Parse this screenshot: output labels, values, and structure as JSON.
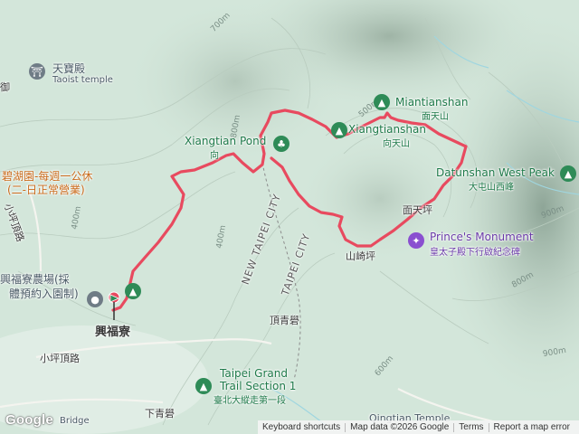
{
  "map": {
    "route_color": "#e84a5f",
    "labels": {
      "tianbao_zh": "天寶殿",
      "tianbao_en": "Taoist temple",
      "miantianshan_en": "Miantianshan",
      "miantianshan_zh": "面天山",
      "xiangtian_en": "Xiangtian Pond",
      "xiangtian_zh": "向",
      "xiangtianshan_en": "Xiangtianshan",
      "xiangtianshan_zh": "向天山",
      "datun_west_en": "Datunshan West Peak",
      "datun_west_zh": "大屯山西峰",
      "mian_tianping": "面天坪",
      "prince_en": "Prince's Monument",
      "prince_zh": "皇太子殿下行啟紀念碑",
      "shanyu": "山崎坪",
      "biyu_line1": "碧湖園-每週一公休",
      "biyu_line2": "(二-日正常營業)",
      "xingfu_farm1": "興福寮農場(採",
      "xingfu_farm2": "體預約入園制)",
      "xingfuliao": "興福寮",
      "new_taipei": "NEW TAIPEI CITY",
      "taipei": "TAIPEI CITY",
      "dingqing": "頂青礐",
      "xiaping_top": "小坪頂路",
      "xiaping_left": "小坪頂路",
      "trail_en1": "Taipei Grand",
      "trail_en2": "Trail Section 1",
      "trail_zh": "臺北大縱走第一段",
      "xiaqing": "下青礐",
      "qingtian": "Qingtian Temple",
      "bridge": "Bridge",
      "left_edge_zh": "御",
      "c700a": "700m",
      "c600a": "600m",
      "c500a": "500m",
      "c400a": "400m",
      "c400b": "400m",
      "c800a": "800m",
      "c900a": "900m",
      "c800b": "800m",
      "c900b": "900m"
    }
  },
  "footer": {
    "keyboard": "Keyboard shortcuts",
    "mapdata": "Map data ©2026 Google",
    "terms": "Terms",
    "report": "Report a map error"
  },
  "logo": "Google"
}
